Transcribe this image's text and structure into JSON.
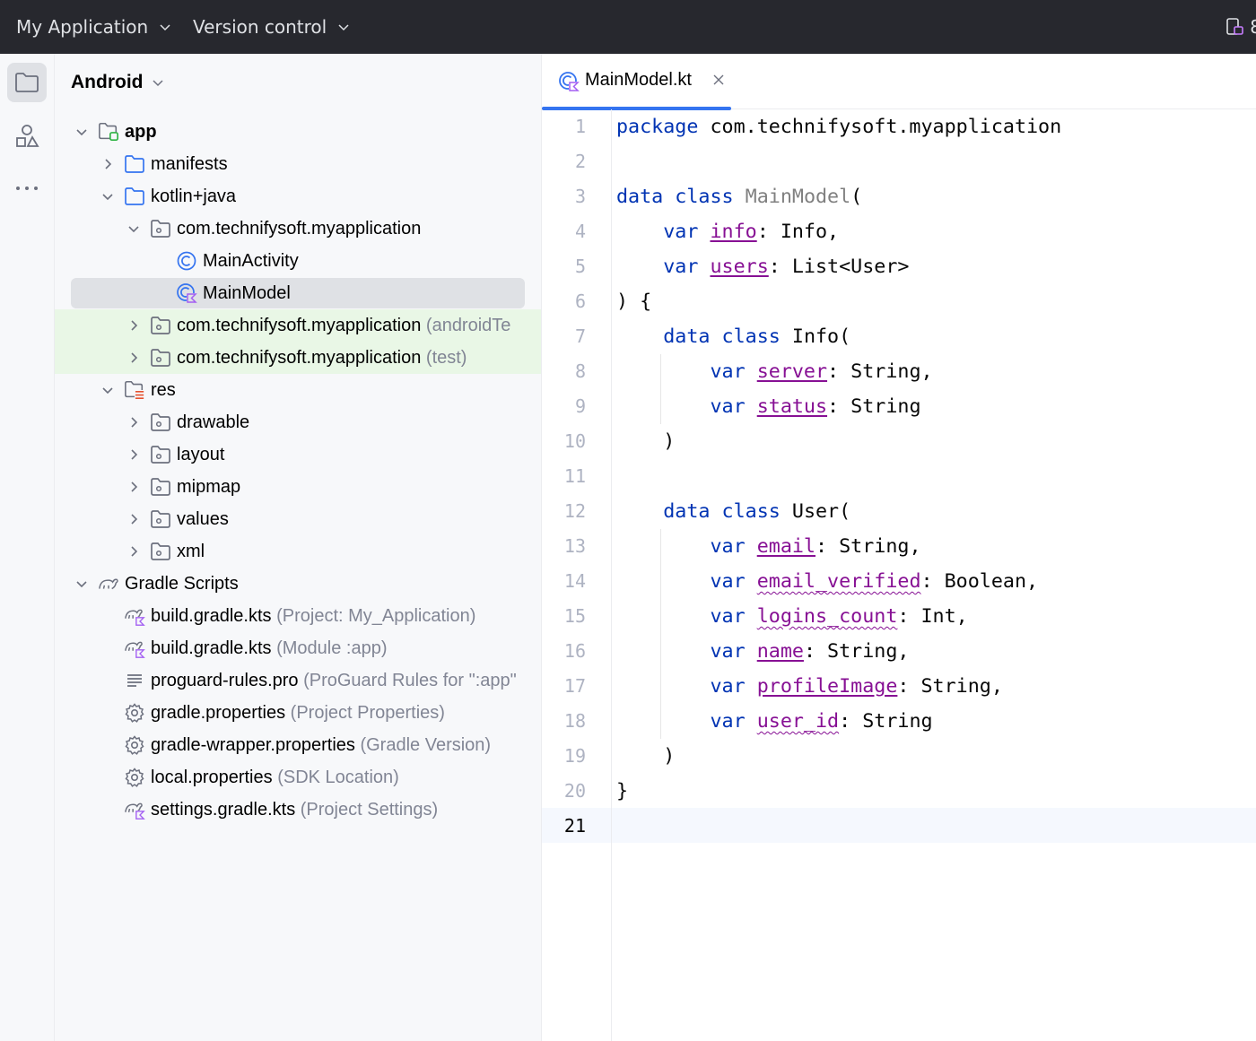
{
  "topbar": {
    "project_menu": "My Application",
    "vcs_menu": "Version control",
    "right_fragment": "8"
  },
  "project_panel": {
    "view_selector": "Android",
    "tree": [
      {
        "label": "app",
        "hint": ""
      },
      {
        "label": "manifests",
        "hint": ""
      },
      {
        "label": "kotlin+java",
        "hint": ""
      },
      {
        "label": "com.technifysoft.myapplication",
        "hint": ""
      },
      {
        "label": "MainActivity",
        "hint": ""
      },
      {
        "label": "MainModel",
        "hint": ""
      },
      {
        "label": "com.technifysoft.myapplication",
        "hint": "(androidTe"
      },
      {
        "label": "com.technifysoft.myapplication",
        "hint": "(test)"
      },
      {
        "label": "res",
        "hint": ""
      },
      {
        "label": "drawable",
        "hint": ""
      },
      {
        "label": "layout",
        "hint": ""
      },
      {
        "label": "mipmap",
        "hint": ""
      },
      {
        "label": "values",
        "hint": ""
      },
      {
        "label": "xml",
        "hint": ""
      },
      {
        "label": "Gradle Scripts",
        "hint": ""
      },
      {
        "label": "build.gradle.kts",
        "hint": "(Project: My_Application)"
      },
      {
        "label": "build.gradle.kts",
        "hint": "(Module :app)"
      },
      {
        "label": "proguard-rules.pro",
        "hint": "(ProGuard Rules for \":app\""
      },
      {
        "label": "gradle.properties",
        "hint": "(Project Properties)"
      },
      {
        "label": "gradle-wrapper.properties",
        "hint": "(Gradle Version)"
      },
      {
        "label": "local.properties",
        "hint": "(SDK Location)"
      },
      {
        "label": "settings.gradle.kts",
        "hint": "(Project Settings)"
      }
    ]
  },
  "editor": {
    "tab": {
      "label": "MainModel.kt"
    },
    "line_numbers": [
      "1",
      "2",
      "3",
      "4",
      "5",
      "6",
      "7",
      "8",
      "9",
      "10",
      "11",
      "12",
      "13",
      "14",
      "15",
      "16",
      "17",
      "18",
      "19",
      "20",
      "21"
    ],
    "current_line": "21",
    "code": {
      "l1_kw": "package",
      "l1_rest": " com.technifysoft.myapplication",
      "l3_kw1": "data",
      "l3_kw2": "class",
      "l3_name": "MainModel",
      "l3_rest": "(",
      "l4_kw": "var",
      "l4_prop": "info",
      "l4_rest": ": Info,",
      "l5_kw": "var",
      "l5_prop": "users",
      "l5_rest": ": List<User>",
      "l6": ") {",
      "l7_kw1": "data",
      "l7_kw2": "class",
      "l7_rest": " Info(",
      "l8_kw": "var",
      "l8_prop": "server",
      "l8_rest": ": String,",
      "l9_kw": "var",
      "l9_prop": "status",
      "l9_rest": ": String",
      "l10": ")",
      "l12_kw1": "data",
      "l12_kw2": "class",
      "l12_rest": " User(",
      "l13_kw": "var",
      "l13_prop": "email",
      "l13_rest": ": String,",
      "l14_kw": "var",
      "l14_prop": "email_verified",
      "l14_rest": ": Boolean,",
      "l15_kw": "var",
      "l15_prop": "logins_count",
      "l15_rest": ": Int,",
      "l16_kw": "var",
      "l16_prop": "name",
      "l16_rest": ": String,",
      "l17_kw": "var",
      "l17_prop": "profileImage",
      "l17_rest": ": String,",
      "l18_kw": "var",
      "l18_prop": "user_id",
      "l18_rest": ": String",
      "l19": ")",
      "l20": "}"
    }
  },
  "icons": {
    "folder": "folder-icon",
    "package": "package-icon",
    "class": "kotlin-class-icon",
    "gradle": "gradle-icon",
    "settings": "gear-icon"
  },
  "colors": {
    "keyword": "#0033b3",
    "property": "#871094",
    "accent": "#3574f0",
    "test_highlight": "#e9f7e6"
  }
}
